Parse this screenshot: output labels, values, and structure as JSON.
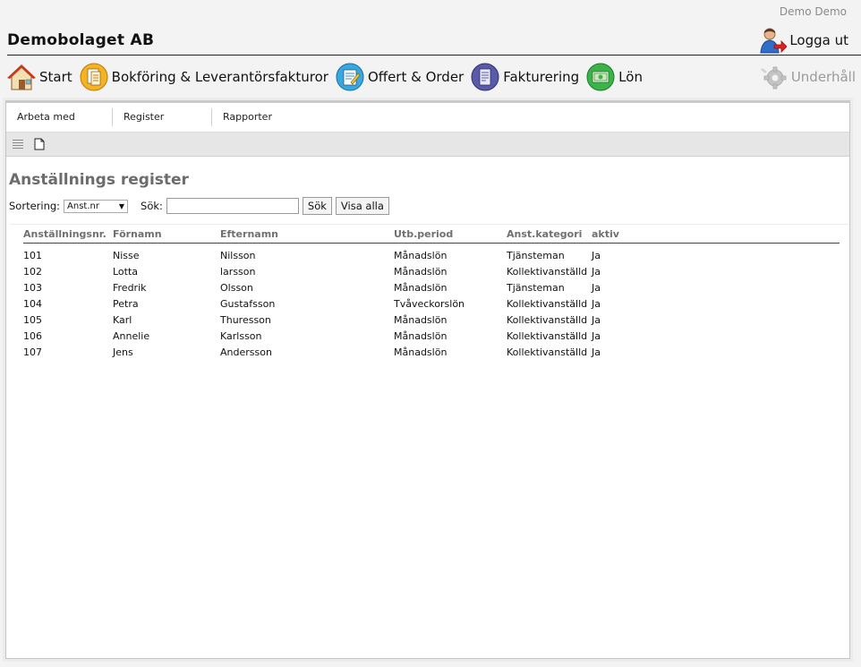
{
  "header": {
    "user": "Demo Demo",
    "company": "Demobolaget AB",
    "logout_label": "Logga ut"
  },
  "mainnav": {
    "items": [
      {
        "label": "Start",
        "icon": "home-icon"
      },
      {
        "label": "Bokföring & Leverantörsfakturor",
        "icon": "accounting-icon"
      },
      {
        "label": "Offert & Order",
        "icon": "offer-order-icon"
      },
      {
        "label": "Fakturering",
        "icon": "invoice-icon"
      },
      {
        "label": "Lön",
        "icon": "payroll-icon"
      }
    ],
    "maintenance_label": "Underhåll"
  },
  "subnav": {
    "tabs": [
      "Arbeta med",
      "Register",
      "Rapporter"
    ]
  },
  "page": {
    "title": "Anställnings register",
    "sort_label": "Sortering:",
    "sort_value": "Anst.nr",
    "search_label": "Sök:",
    "search_value": "",
    "search_button": "Sök",
    "show_all_button": "Visa alla"
  },
  "table": {
    "columns": [
      "Anställningsnr.",
      "Förnamn",
      "Efternamn",
      "Utb.period",
      "Anst.kategori",
      "aktiv"
    ],
    "rows": [
      [
        "101",
        "Nisse",
        "Nilsson",
        "Månadslön",
        "Tjänsteman",
        "Ja"
      ],
      [
        "102",
        "Lotta",
        "larsson",
        "Månadslön",
        "Kollektivanställd",
        "Ja"
      ],
      [
        "103",
        "Fredrik",
        "Olsson",
        "Månadslön",
        "Tjänsteman",
        "Ja"
      ],
      [
        "104",
        "Petra",
        "Gustafsson",
        "Tvåveckorslön",
        "Kollektivanställd",
        "Ja"
      ],
      [
        "105",
        "Karl",
        "Thuresson",
        "Månadslön",
        "Kollektivanställd",
        "Ja"
      ],
      [
        "106",
        "Annelie",
        "Karlsson",
        "Månadslön",
        "Kollektivanställd",
        "Ja"
      ],
      [
        "107",
        "Jens",
        "Andersson",
        "Månadslön",
        "Kollektivanställd",
        "Ja"
      ]
    ]
  },
  "colors": {
    "heading": "#6c6c6c",
    "toolbar_bg": "#e6e6e6",
    "disabled_text": "#9a9a9a"
  }
}
